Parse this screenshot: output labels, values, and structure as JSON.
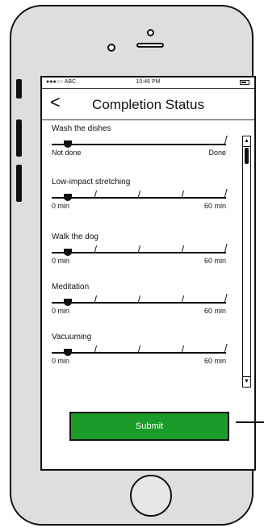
{
  "status_bar": {
    "carrier": "●●●○○ ABC",
    "time": "10:46 PM"
  },
  "nav": {
    "title": "Completion Status"
  },
  "tasks": [
    {
      "label": "Wash the dishes",
      "min_label": "Not done",
      "max_label": "Done",
      "value_fraction": 0.07,
      "ticks": []
    },
    {
      "label": "Low-impact stretching",
      "min_label": "0 min",
      "max_label": "60 min",
      "value_fraction": 0.07,
      "ticks": [
        0.25,
        0.5,
        0.75
      ]
    },
    {
      "label": "Walk the dog",
      "min_label": "0 min",
      "max_label": "60 min",
      "value_fraction": 0.07,
      "ticks": [
        0.25,
        0.5,
        0.75
      ]
    },
    {
      "label": "Meditation",
      "min_label": "0 min",
      "max_label": "60 min",
      "value_fraction": 0.07,
      "ticks": [
        0.25,
        0.5,
        0.75
      ]
    },
    {
      "label": "Vacuuming",
      "min_label": "0 min",
      "max_label": "60 min",
      "value_fraction": 0.07,
      "ticks": [
        0.25,
        0.5,
        0.75
      ]
    }
  ],
  "submit": {
    "label": "Submit"
  },
  "colors": {
    "submit_bg": "#1a9b2a"
  },
  "icons": {
    "back": "chevron-left-icon",
    "scroll_up": "arrow-up-icon",
    "scroll_down": "arrow-down-icon"
  }
}
